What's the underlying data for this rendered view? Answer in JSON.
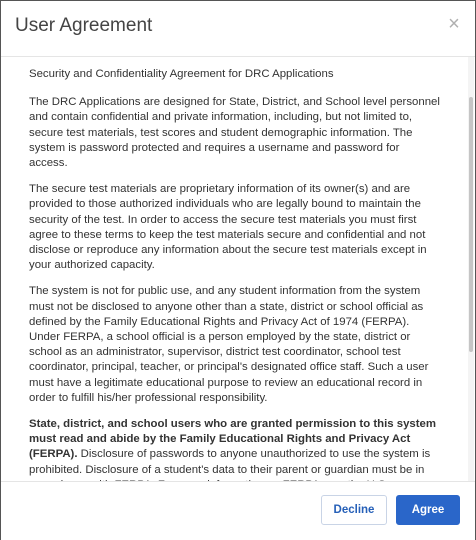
{
  "dialog": {
    "title": "User Agreement",
    "close_glyph": "×"
  },
  "content": {
    "lead": "Security and Confidentiality Agreement for DRC Applications",
    "p1": "The DRC Applications are designed for State, District, and School level personnel and contain confidential and private information, including, but not limited to, secure test materials, test scores and student demographic information. The system is password protected and requires a username and password for access.",
    "p2": "The secure test materials are proprietary information of its owner(s) and are provided to those authorized individuals who are legally bound to maintain the security of the test. In order to access the secure test materials you must first agree to these terms to keep the test materials secure and confidential and not disclose or reproduce any information about the secure test materials except in your authorized capacity.",
    "p3": "The system is not for public use, and any student information from the system must not be disclosed to anyone other than a state, district or school official as defined by the Family Educational Rights and Privacy Act of 1974 (FERPA). Under FERPA, a school official is a person employed by the state, district or school as an administrator, supervisor, district test coordinator, school test coordinator, principal, teacher, or principal's designated office staff. Such a user must have a legitimate educational purpose to review an educational record in order to fulfill his/her professional responsibility.",
    "p4_bold": "State, district, and school users who are granted permission to this system must read and abide by the Family Educational Rights and Privacy Act (FERPA).",
    "p4_rest": " Disclosure of passwords to anyone unauthorized to use the system is prohibited. Disclosure of a student's data to their parent or guardian must be in accordance with FERPA. For more information on FERPA, see the U.S."
  },
  "footer": {
    "decline_label": "Decline",
    "agree_label": "Agree"
  },
  "colors": {
    "accent": "#2a66c9",
    "decline_text": "#2660b8"
  }
}
